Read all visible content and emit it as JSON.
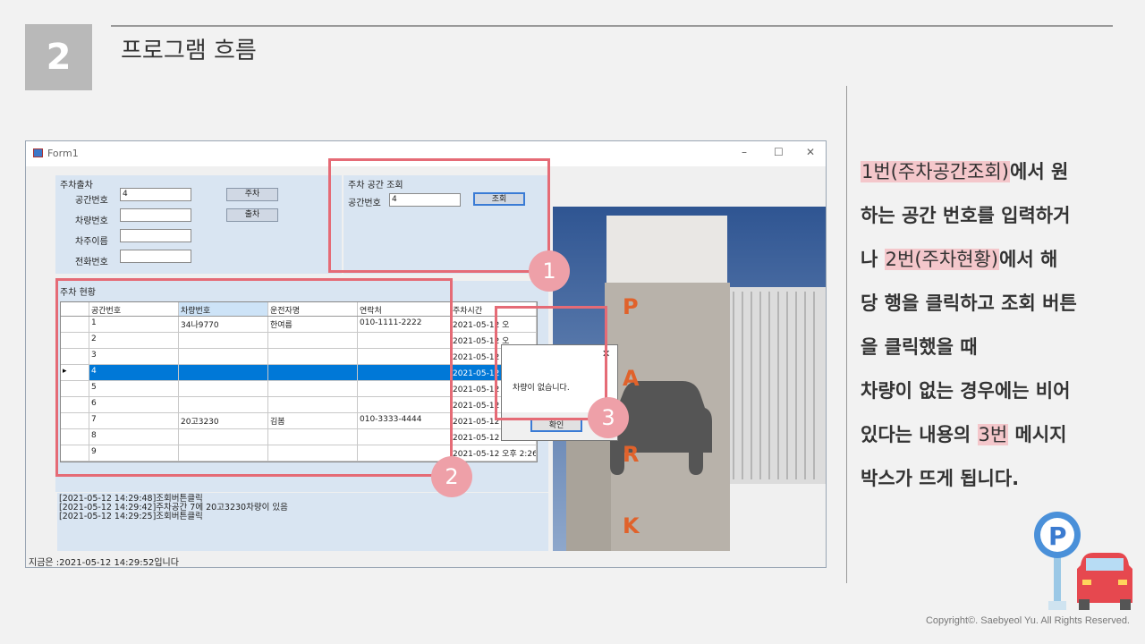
{
  "slide": {
    "number": "2",
    "title": "프로그램 흐름",
    "copyright": "Copyright©. Saebyeol Yu. All Rights Reserved."
  },
  "description": {
    "p1a": "1번(주차공간조회)",
    "p1b": "에서 원",
    "p2": "하는 공간 번호를 입력하거",
    "p3a": "나 ",
    "p3b": "2번(주차현황)",
    "p3c": "에서 해",
    "p4": "당 행을 클릭하고 조회 버튼",
    "p5": "을 클릭했을 때",
    "p6": "차량이 없는 경우에는 비어",
    "p7a": "있다는 내용의 ",
    "p7b": "3번",
    "p7c": " 메시지",
    "p8": "박스가 뜨게 됩니다."
  },
  "window": {
    "title": "Form1",
    "minimize": "–",
    "maximize": "☐",
    "close": "✕",
    "status": "지금은 :2021-05-12 14:29:52입니다"
  },
  "parking_io": {
    "group_label": "주차출차",
    "space_label": "공간번호",
    "space_value": "4",
    "car_label": "차량번호",
    "car_value": "",
    "owner_label": "차주이름",
    "owner_value": "",
    "phone_label": "전화번호",
    "phone_value": "",
    "park_button": "주차",
    "exit_button": "출차"
  },
  "lookup": {
    "group_label": "주차 공간 조회",
    "space_label": "공간번호",
    "space_value": "4",
    "search_button": "조회"
  },
  "status_grid": {
    "group_label": "주차 현황",
    "columns": [
      "공간번호",
      "차량번호",
      "운전자명",
      "연락처",
      "주차시간"
    ],
    "rows": [
      [
        "1",
        "34나9770",
        "한여름",
        "010-1111-2222",
        "2021-05-12 오"
      ],
      [
        "2",
        "",
        "",
        "",
        "2021-05-12 오"
      ],
      [
        "3",
        "",
        "",
        "",
        "2021-05-12 오"
      ],
      [
        "4",
        "",
        "",
        "",
        "2021-05-12 오"
      ],
      [
        "5",
        "",
        "",
        "",
        "2021-05-12 오"
      ],
      [
        "6",
        "",
        "",
        "",
        "2021-05-12 오"
      ],
      [
        "7",
        "20고3230",
        "김봄",
        "010-3333-4444",
        "2021-05-12 오후 2:26"
      ],
      [
        "8",
        "",
        "",
        "",
        "2021-05-12 오후 2:26"
      ],
      [
        "9",
        "",
        "",
        "",
        "2021-05-12 오후 2:26"
      ]
    ],
    "selected_row_marker": "▸"
  },
  "log": {
    "lines": [
      "[2021-05-12 14:29:48]조회버튼클릭",
      "[2021-05-12 14:29:42]주차공간 7에 20고3230차량이 있음",
      "[2021-05-12 14:29:25]조회버튼클릭"
    ]
  },
  "dialog": {
    "message": "차량이 없습니다.",
    "ok_button": "확인",
    "close": "✕"
  },
  "photo": {
    "letters": [
      "P",
      "A",
      "R",
      "K"
    ]
  },
  "callouts": [
    "1",
    "2",
    "3"
  ],
  "colors": {
    "highlight": "#f4c7cb",
    "callout": "#eea0a8",
    "callout_border": "#e56b76",
    "selection": "#0078d7"
  }
}
